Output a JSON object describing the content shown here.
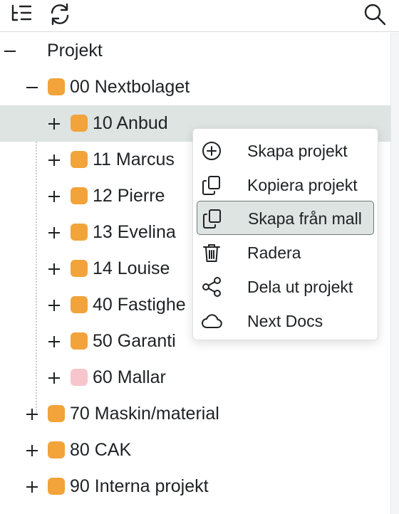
{
  "toolbar": {
    "tree_view_icon": "tree-structure-icon",
    "refresh_icon": "refresh-icon",
    "search_icon": "search-icon"
  },
  "tree": {
    "root": {
      "label": "Projekt",
      "toggle": "collapse"
    },
    "group": {
      "label": "00 Nextbolaget",
      "color": "#F2A33A",
      "toggle": "collapse"
    },
    "children": [
      {
        "label": "10 Anbud",
        "color": "#F2A33A",
        "selected": true
      },
      {
        "label": "11 Marcus",
        "color": "#F2A33A"
      },
      {
        "label": "12 Pierre",
        "color": "#F2A33A"
      },
      {
        "label": "13 Evelina",
        "color": "#F2A33A"
      },
      {
        "label": "14 Louise",
        "color": "#F2A33A"
      },
      {
        "label": "40 Fastighe",
        "color": "#F2A33A"
      },
      {
        "label": "50 Garanti",
        "color": "#F2A33A"
      },
      {
        "label": "60 Mallar",
        "color": "#F7C5CC"
      }
    ],
    "top_level": [
      {
        "label": "70 Maskin/material",
        "color": "#F2A33A"
      },
      {
        "label": "80 CAK",
        "color": "#F2A33A"
      },
      {
        "label": "90 Interna projekt",
        "color": "#F2A33A"
      }
    ]
  },
  "context_menu": {
    "items": [
      {
        "label": "Skapa projekt",
        "icon": "plus-circle-icon"
      },
      {
        "label": "Kopiera projekt",
        "icon": "copy-icon"
      },
      {
        "label": "Skapa från mall",
        "icon": "copy-icon",
        "highlighted": true
      },
      {
        "label": "Radera",
        "icon": "trash-icon"
      },
      {
        "label": "Dela ut projekt",
        "icon": "share-icon"
      },
      {
        "label": "Next Docs",
        "icon": "cloud-icon"
      }
    ]
  },
  "colors": {
    "folder_orange": "#F2A33A",
    "folder_pink": "#F7C5CC",
    "selection": "#DDE4E2"
  }
}
